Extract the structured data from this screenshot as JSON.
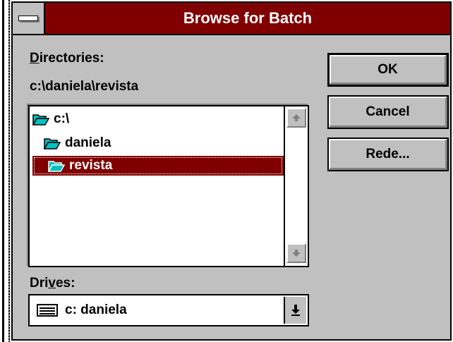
{
  "window": {
    "title": "Browse for Batch"
  },
  "directories": {
    "label_accel": "D",
    "label_rest": "irectories:",
    "current_path": "c:\\daniela\\revista",
    "items": [
      {
        "label": "c:\\",
        "state": "open"
      },
      {
        "label": "daniela",
        "state": "open"
      },
      {
        "label": "revista",
        "state": "open",
        "selected": true
      }
    ]
  },
  "drives": {
    "label_pre": "Dri",
    "label_accel": "v",
    "label_post": "es:",
    "selected": "c: daniela"
  },
  "buttons": {
    "ok": "OK",
    "cancel": "Cancel",
    "rede": "Rede..."
  },
  "colors": {
    "title_bar": "#800000",
    "selection": "#800000",
    "dialog_face": "#c0c0c0",
    "folder": "#00c0c0"
  },
  "icons": {
    "folder": "open-folder-icon",
    "drive": "hard-drive-icon",
    "scroll_up": "arrow-up-icon",
    "scroll_down": "arrow-down-icon",
    "dropdown": "dropdown-arrow-icon",
    "system_menu": "system-menu-icon"
  }
}
